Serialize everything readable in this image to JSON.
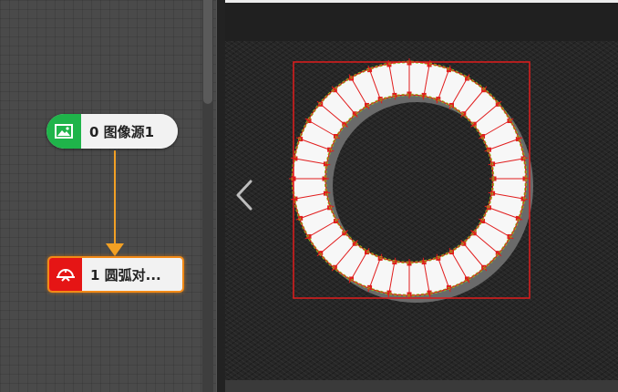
{
  "flow": {
    "nodes": [
      {
        "label": "0 图像源1",
        "icon": "image-icon",
        "color": "#1fb44a"
      },
      {
        "label": "1 圆弧对...",
        "icon": "arc-caliper-icon",
        "color": "#e51515",
        "selected": true
      }
    ],
    "connector_color": "#f2a024"
  },
  "viewer": {
    "nav_prev_icon": "chevron-left-icon",
    "roi_color": "#e11d1d",
    "fit_color": "#7ed321"
  }
}
